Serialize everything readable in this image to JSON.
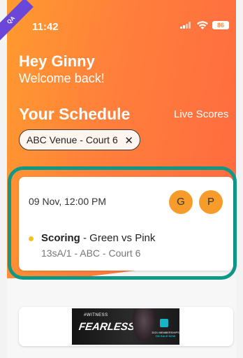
{
  "status_bar": {
    "time": "11:42",
    "battery": "86",
    "badge": "QA"
  },
  "greeting": {
    "title": "Hey Ginny",
    "subtitle": "Welcome back!"
  },
  "schedule": {
    "title": "Your Schedule",
    "live_scores_label": "Live Scores",
    "filter_chip": {
      "label": "ABC Venue - Court 6",
      "close_icon": "close-icon"
    }
  },
  "match_card": {
    "datetime": "09 Nov, 12:00 PM",
    "teams": [
      {
        "initial": "G"
      },
      {
        "initial": "P"
      }
    ],
    "role": "Scoring",
    "matchup": " - Green vs Pink",
    "details": "13sA/1 - ABC - Court 6",
    "status_dot_color": "#f7c218"
  },
  "banner": {
    "tag": "#WITNESS",
    "headline": "FEARLESS",
    "promo_line1": "2021 MEMBERSHIPS",
    "promo_line2": "ON SALE NOW"
  },
  "colors": {
    "hero_start": "#ff9a2f",
    "hero_end": "#ff6a3f",
    "highlight": "#109887",
    "avatar": "#f79c2a",
    "qa_ribbon": "#6b47d9"
  }
}
